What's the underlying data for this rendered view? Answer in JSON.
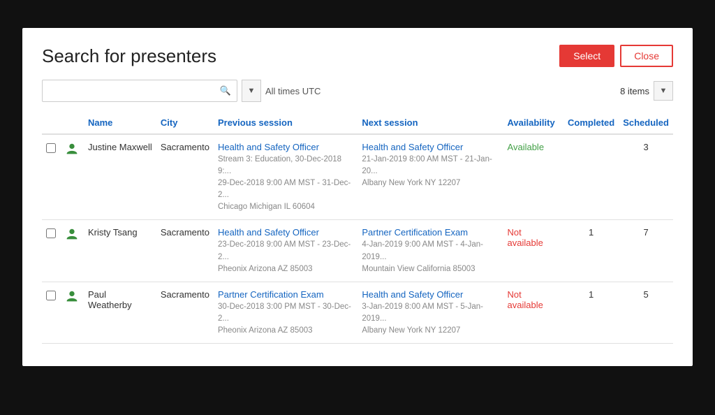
{
  "title": "Search for presenters",
  "buttons": {
    "select": "Select",
    "close": "Close"
  },
  "search": {
    "placeholder": "",
    "utc_label": "All times UTC"
  },
  "items_count": "8 items",
  "columns": {
    "name": "Name",
    "city": "City",
    "previous_session": "Previous session",
    "next_session": "Next session",
    "availability": "Availability",
    "completed": "Completed",
    "scheduled": "Scheduled"
  },
  "rows": [
    {
      "name": "Justine Maxwell",
      "city": "Sacramento",
      "prev_session_title": "Health and Safety Officer",
      "prev_session_detail": "Stream 3: Education, 30-Dec-2018 9:...\n29-Dec-2018 9:00 AM MST - 31-Dec-2...\nChicago Michigan IL 60604",
      "next_session_title": "Health and Safety Officer",
      "next_session_detail": "21-Jan-2019 8:00 AM MST - 21-Jan-20...\nAlbany New York NY 12207",
      "availability": "Available",
      "availability_type": "available",
      "completed": "",
      "scheduled": "3"
    },
    {
      "name": "Kristy Tsang",
      "city": "Sacramento",
      "prev_session_title": "Health and Safety Officer",
      "prev_session_detail": "23-Dec-2018 9:00 AM MST - 23-Dec-2...\nPheonix Arizona AZ 85003",
      "next_session_title": "Partner Certification Exam",
      "next_session_detail": "4-Jan-2019 9:00 AM MST - 4-Jan-2019...\nMountain View California 85003",
      "availability": "Not available",
      "availability_type": "not",
      "completed": "1",
      "scheduled": "7"
    },
    {
      "name": "Paul Weatherby",
      "city": "Sacramento",
      "prev_session_title": "Partner Certification Exam",
      "prev_session_detail": "30-Dec-2018 3:00 PM MST - 30-Dec-2...\nPheonix Arizona AZ 85003",
      "next_session_title": "Health and Safety Officer",
      "next_session_detail": "3-Jan-2019 8:00 AM MST - 5-Jan-2019...\nAlbany New York NY 12207",
      "availability": "Not available",
      "availability_type": "not",
      "completed": "1",
      "scheduled": "5"
    }
  ]
}
